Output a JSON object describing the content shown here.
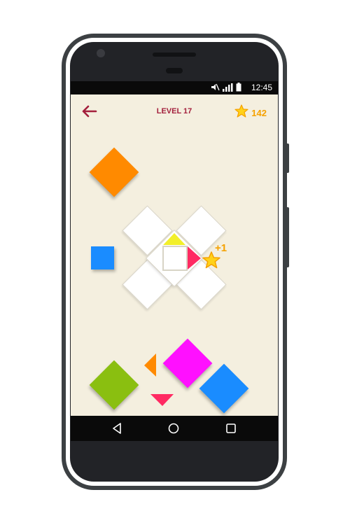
{
  "status_bar": {
    "time": "12:45",
    "icons": [
      "mute-icon",
      "signal-icon",
      "battery-icon"
    ]
  },
  "header": {
    "back_icon": "arrow-left-icon",
    "level_label": "LEVEL 17",
    "score_icon": "star-icon",
    "score_value": "142"
  },
  "board": {
    "bonus_text": "+1",
    "bonus_icon": "star-icon"
  },
  "pieces": [
    {
      "name": "orange-diamond",
      "color": "#ff8a00"
    },
    {
      "name": "blue-square",
      "color": "#1a8cff"
    },
    {
      "name": "green-diamond",
      "color": "#8abf10"
    },
    {
      "name": "magenta-diamond",
      "color": "#ff10ff"
    },
    {
      "name": "blue-diamond",
      "color": "#1a8cff"
    },
    {
      "name": "orange-triangle",
      "color": "#ff8a00"
    },
    {
      "name": "pink-triangle",
      "color": "#ff2a62"
    }
  ],
  "accent_colors": {
    "level_red": "#a31f3c",
    "score_orange": "#f5a100",
    "yellow_piece": "#f2ef2a",
    "pink_piece": "#ff2a62",
    "background": "#f4efdf"
  },
  "navigation": {
    "back": "nav-back-icon",
    "home": "nav-home-icon",
    "recents": "nav-recents-icon"
  }
}
